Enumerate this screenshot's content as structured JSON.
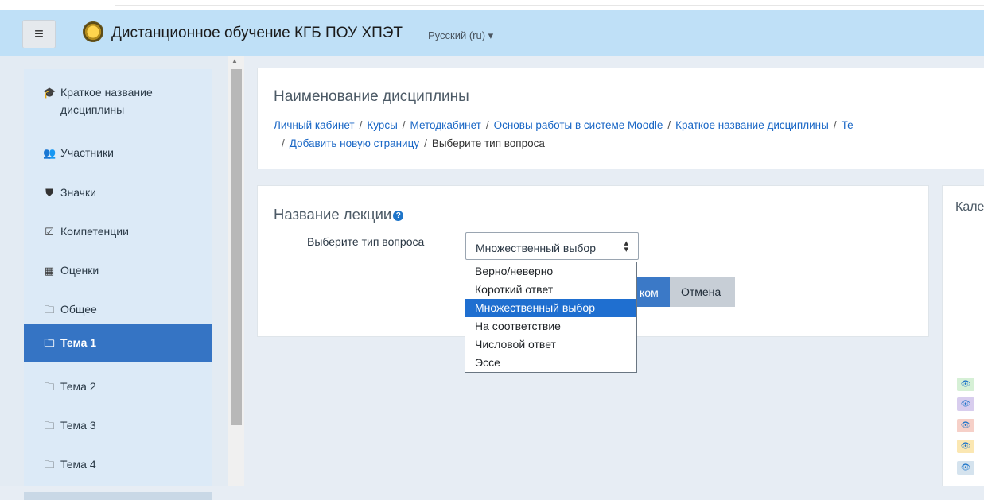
{
  "header": {
    "menu_icon": "hamburger-icon",
    "site_title": "Дистанционное обучение КГБ ПОУ ХПЭТ",
    "language": "Русский (ru) ▾"
  },
  "sidebar": {
    "items": [
      {
        "label": "Краткое название дисциплины",
        "icon": "graduation-cap-icon",
        "glyph": "🎓"
      },
      {
        "label": "Участники",
        "icon": "users-icon",
        "glyph": "👥"
      },
      {
        "label": "Значки",
        "icon": "shield-icon",
        "glyph": "⛊"
      },
      {
        "label": "Компетенции",
        "icon": "checkbox-icon",
        "glyph": "☑"
      },
      {
        "label": "Оценки",
        "icon": "table-icon",
        "glyph": "▦"
      },
      {
        "label": "Общее",
        "icon": "folder-icon",
        "glyph": "🗀"
      },
      {
        "label": "Тема 1",
        "icon": "folder-icon",
        "glyph": "🗀",
        "active": true
      },
      {
        "label": "Тема 2",
        "icon": "folder-icon",
        "glyph": "🗀"
      },
      {
        "label": "Тема 3",
        "icon": "folder-icon",
        "glyph": "🗀"
      },
      {
        "label": "Тема 4",
        "icon": "folder-icon",
        "glyph": "🗀"
      }
    ]
  },
  "page_header": {
    "title": "Наименование дисциплины",
    "breadcrumb": [
      "Личный кабинет",
      "Курсы",
      "Методкабинет",
      "Основы работы в системе Moodle",
      "Краткое название дисциплины",
      "Те"
    ],
    "breadcrumb_line2": [
      "Добавить новую страницу",
      "Выберите тип вопроса"
    ]
  },
  "main": {
    "lecture_title": "Название лекции",
    "field_label": "Выберите тип вопроса",
    "select_value": "Множественный выбор",
    "options": [
      "Верно/неверно",
      "Короткий ответ",
      "Множественный выбор",
      "На соответствие",
      "Числовой ответ",
      "Эссе"
    ],
    "selected_option": "Множественный выбор",
    "submit_label": "ком",
    "cancel_label": "Отмена"
  },
  "right_block": {
    "title": "Кале",
    "eye_colors": [
      "#d6f0d6",
      "#d8cdee",
      "#f6d0c8",
      "#fbe7b2",
      "#d5e3ee"
    ]
  },
  "colors": {
    "navbar": "#bfe0f7",
    "active_item": "#3574c4",
    "link": "#1866c5",
    "selected_option": "#1f6fd0"
  }
}
